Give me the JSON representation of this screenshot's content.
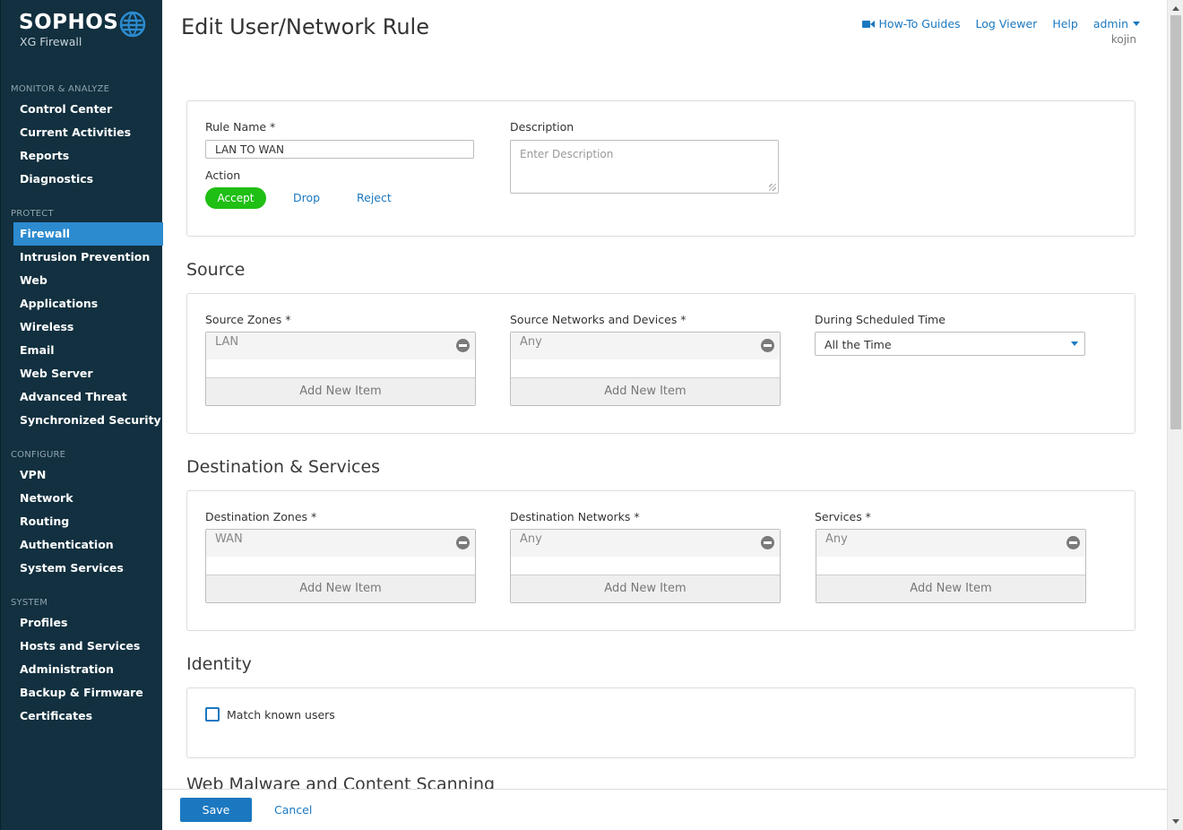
{
  "brand": {
    "name": "SOPHOS",
    "product": "XG Firewall"
  },
  "sidebar": {
    "sections": [
      {
        "title": "MONITOR & ANALYZE",
        "items": [
          "Control Center",
          "Current Activities",
          "Reports",
          "Diagnostics"
        ]
      },
      {
        "title": "PROTECT",
        "items": [
          "Firewall",
          "Intrusion Prevention",
          "Web",
          "Applications",
          "Wireless",
          "Email",
          "Web Server",
          "Advanced Threat",
          "Synchronized Security"
        ]
      },
      {
        "title": "CONFIGURE",
        "items": [
          "VPN",
          "Network",
          "Routing",
          "Authentication",
          "System Services"
        ]
      },
      {
        "title": "SYSTEM",
        "items": [
          "Profiles",
          "Hosts and Services",
          "Administration",
          "Backup & Firmware",
          "Certificates"
        ]
      }
    ],
    "active_item": "Firewall"
  },
  "header": {
    "title": "Edit User/Network Rule",
    "links": {
      "guides": "How-To Guides",
      "log": "Log Viewer",
      "help": "Help",
      "admin": "admin"
    },
    "username": "kojin"
  },
  "rule": {
    "name_label": "Rule Name *",
    "name_value": "LAN TO WAN",
    "description_label": "Description",
    "description_placeholder": "Enter Description",
    "action_label": "Action",
    "actions": {
      "accept": "Accept",
      "drop": "Drop",
      "reject": "Reject"
    },
    "selected_action": "Accept"
  },
  "source": {
    "title": "Source",
    "zones_label": "Source Zones *",
    "zones_value": "LAN",
    "networks_label": "Source Networks and Devices *",
    "networks_value": "Any",
    "schedule_label": "During Scheduled Time",
    "schedule_value": "All the Time"
  },
  "destination": {
    "title": "Destination & Services",
    "zones_label": "Destination Zones *",
    "zones_value": "WAN",
    "networks_label": "Destination Networks *",
    "networks_value": "Any",
    "services_label": "Services *",
    "services_value": "Any"
  },
  "add_new_item": "Add New Item",
  "identity": {
    "title": "Identity",
    "match_label": "Match known users",
    "match_checked": false
  },
  "next_section_title": "Web Malware and Content Scanning",
  "footer": {
    "save": "Save",
    "cancel": "Cancel"
  },
  "colors": {
    "sidebar_bg": "#12303f",
    "active_nav": "#2c8bcf",
    "accent": "#1b78c0",
    "accept": "#1fbf13"
  },
  "icons": [
    "globe-icon",
    "video-icon",
    "chevron-down-icon",
    "remove-icon",
    "checkbox-icon"
  ]
}
